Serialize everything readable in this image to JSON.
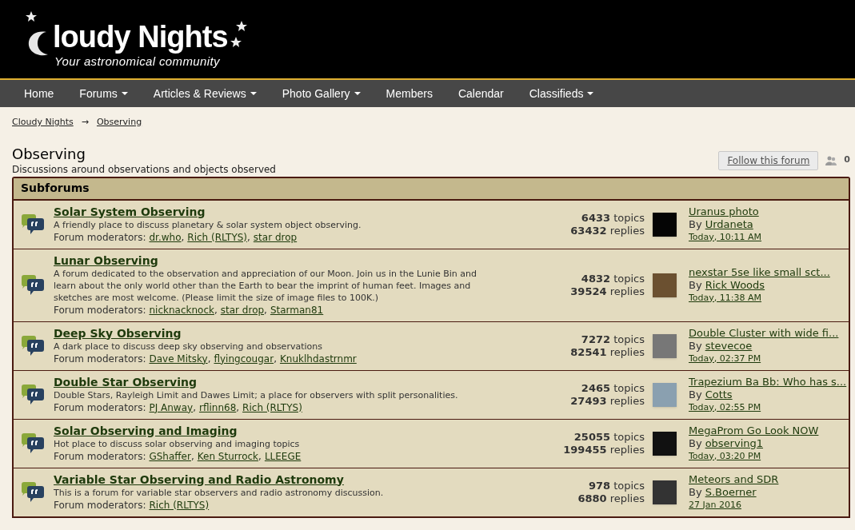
{
  "header": {
    "logo_text": "loudy Nights",
    "tagline": "Your astronomical community"
  },
  "nav": [
    {
      "label": "Home",
      "has_menu": false
    },
    {
      "label": "Forums",
      "has_menu": true
    },
    {
      "label": "Articles & Reviews",
      "has_menu": true
    },
    {
      "label": "Photo Gallery",
      "has_menu": true
    },
    {
      "label": "Members",
      "has_menu": false
    },
    {
      "label": "Calendar",
      "has_menu": false
    },
    {
      "label": "Classifieds",
      "has_menu": true
    }
  ],
  "breadcrumb": {
    "items": [
      "Cloudy Nights",
      "Observing"
    ],
    "separator": "→"
  },
  "forum": {
    "title": "Observing",
    "description": "Discussions around observations and objects observed",
    "follow_button": "Follow this forum",
    "followers": "0"
  },
  "subforums": {
    "heading": "Subforums",
    "rows": [
      {
        "title": "Solar System Observing",
        "description": "A friendly place to discuss planetary & solar system object observing.",
        "moderators_label": "Forum moderators:",
        "moderators": [
          {
            "name": "dr.who",
            "after": ","
          },
          {
            "name": "Rich (RLTYS)",
            "after": ","
          },
          {
            "name": "star drop"
          }
        ],
        "topics": "**6433** topics",
        "replies": "**63432** replies",
        "last_post": {
          "title": "Uranus photo",
          "by": "By",
          "author": "Urdaneta",
          "time": "Today, 10:11 AM"
        }
      },
      {
        "title": "Lunar Observing",
        "description": "A forum dedicated to the observation and appreciation of our Moon. Join us in the Lunie Bin and learn about the only world other than the Earth to bear the imprint of human feet. Images and sketches are most welcome. (Please limit the size of image files to 100K.)",
        "moderators_label": "Forum moderators:",
        "moderators": [
          {
            "name": "nicknacknock",
            "after": ","
          },
          {
            "name": "star drop",
            "after": ","
          },
          {
            "name": "Starman81"
          }
        ],
        "topics": "**4832** topics",
        "replies": "**39524** replies",
        "last_post": {
          "title": "nexstar 5se like small sct...",
          "by": "By",
          "author": "Rick Woods",
          "time": "Today, 11:38 AM"
        }
      },
      {
        "title": "Deep Sky Observing",
        "description": "A dark place to discuss deep sky observing and observations",
        "moderators_label": "Forum moderators:",
        "moderators": [
          {
            "name": "Dave Mitsky",
            "after": ","
          },
          {
            "name": "flyingcougar",
            "after": ","
          },
          {
            "name": "Knuklhdastrnmr"
          }
        ],
        "topics": "**7272** topics",
        "replies": "**82541** replies",
        "last_post": {
          "title": "Double Cluster with wide fi...",
          "by": "By",
          "author": "stevecoe",
          "time": "Today, 02:37 PM"
        }
      },
      {
        "title": "Double Star Observing",
        "description": "Double Stars, Rayleigh Limit and Dawes Limit; a place for observers with split personalities.",
        "moderators_label": "Forum moderators:",
        "moderators": [
          {
            "name": "PJ Anway",
            "after": ","
          },
          {
            "name": "rflinn68",
            "after": ","
          },
          {
            "name": "Rich (RLTYS)"
          }
        ],
        "topics": "**2465** topics",
        "replies": "**27493** replies",
        "last_post": {
          "title": "Trapezium Ba Bb: Who has s...",
          "by": "By",
          "author": "Cotts",
          "time": "Today, 02:55 PM"
        }
      },
      {
        "title": "Solar Observing and Imaging",
        "description": "Hot place to discuss solar observing and imaging topics",
        "moderators_label": "Forum moderators:",
        "moderators": [
          {
            "name": "GShaffer",
            "after": ","
          },
          {
            "name": "Ken Sturrock",
            "after": ","
          },
          {
            "name": "LLEEGE"
          }
        ],
        "topics": "**25055** topics",
        "replies": "**199455** replies",
        "last_post": {
          "title": "MegaProm Go Look NOW",
          "by": "By",
          "author": "observing1",
          "time": "Today, 03:20 PM"
        }
      },
      {
        "title": "Variable Star Observing and Radio Astronomy",
        "description": "This is a forum for variable star observers and radio astronomy discussion.",
        "moderators_label": "Forum moderators:",
        "moderators": [
          {
            "name": "Rich (RLTYS)"
          }
        ],
        "topics": "**978** topics",
        "replies": "**6880** replies",
        "last_post": {
          "title": "Meteors and SDR",
          "by": "By",
          "author": "S.Boerner",
          "time": "27 Jan 2016"
        }
      }
    ]
  }
}
